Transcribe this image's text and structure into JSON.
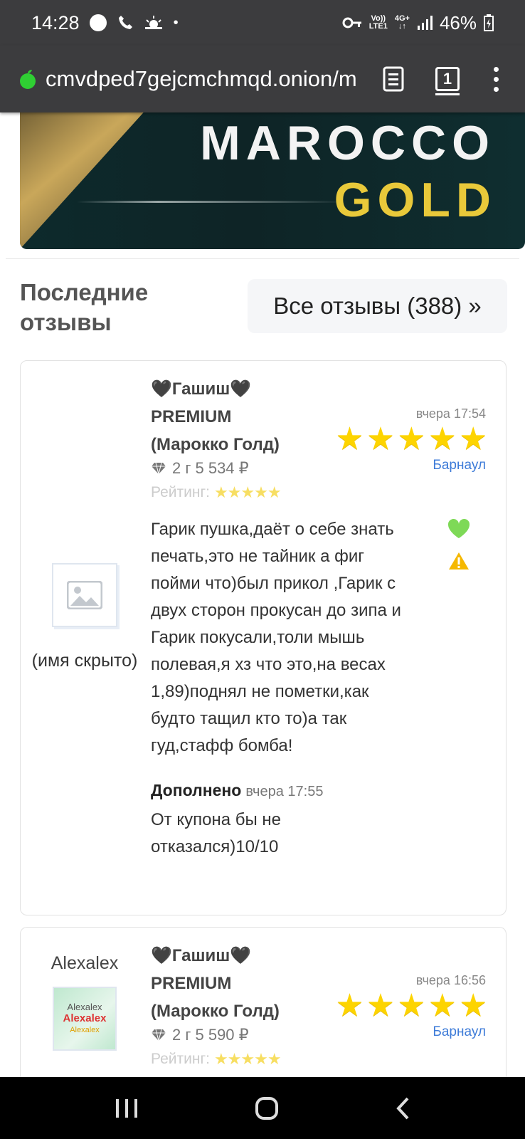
{
  "status_bar": {
    "time": "14:28",
    "lte_top": "Vo))",
    "lte_bottom": "LTE1",
    "net_top": "4G+",
    "net_bottom": "↓↑",
    "battery": "46%"
  },
  "browser": {
    "url_visible": "cmvdped7gejcmchmqd.onion/m",
    "tab_count": "1"
  },
  "banner": {
    "line1": "MAROCCO",
    "line2": "GOLD"
  },
  "section": {
    "title": "Последние отзывы",
    "all_reviews_button": "Все отзывы (388) »"
  },
  "reviews": [
    {
      "author": "(имя скрыто)",
      "product_line1": "🖤Гашиш🖤",
      "product_line2": "PREMIUM",
      "product_line3": "(Марокко Голд)",
      "price": "2 г 5 534 ₽",
      "rating_label": "Рейтинг:",
      "rating_stars": "★★★★★",
      "date": "вчера 17:54",
      "stars": 5,
      "city": "Барнаул",
      "text": "Гарик пушка,даёт о себе знать печать,это не тайник а фиг пойми что)был прикол ,Гарик с двух сторон прокусан до зипа и Гарик покусали,толи мышь полевая,я хз что это,на весах 1,89)поднял не пометки,как будто тащил кто то)а так гуд,стафф бомба!",
      "added_label": "Дополнено",
      "added_date": "вчера 17:55",
      "added_text": "От купона бы не отказался)10/10"
    },
    {
      "author": "Alexalex",
      "avatar_text": "Alexalex",
      "product_line1": "🖤Гашиш🖤",
      "product_line2": "PREMIUM",
      "product_line3": "(Марокко Голд)",
      "price": "2 г 5 590 ₽",
      "rating_label": "Рейтинг:",
      "rating_stars": "★★★★★",
      "date": "вчера 16:56",
      "stars": 5,
      "city": "Барнаул"
    }
  ],
  "colors": {
    "bar_bg": "#3c3c3e",
    "star": "#fdd400",
    "link": "#3d7bd8",
    "like": "#7ed957",
    "warning": "#f5b800"
  }
}
